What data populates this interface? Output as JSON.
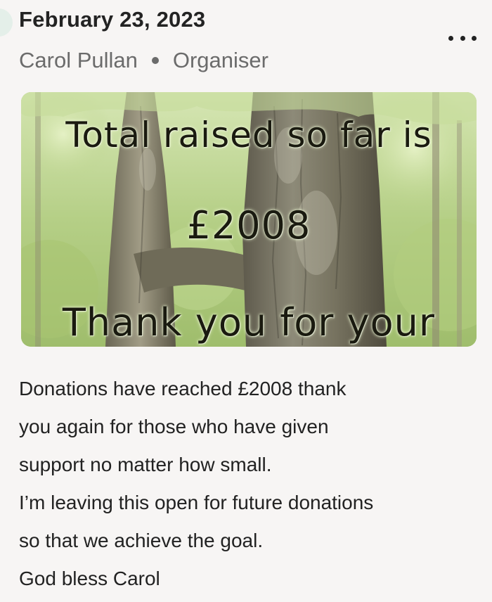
{
  "update": {
    "date": "February 23, 2023",
    "author": "Carol Pullan",
    "role": "Organiser",
    "more_icon": "more-horizontal-icon",
    "image": {
      "overlay_line1": "Total raised so far is",
      "overlay_line2": "£2008",
      "overlay_line3": "Thank you for your"
    },
    "body_lines": [
      "Donations have reached £2008 thank",
      "you again for those who have given",
      "support no matter how small.",
      "I’m leaving this open for future donations",
      "so that we achieve the goal.",
      "God bless Carol"
    ]
  },
  "colors": {
    "background": "#f7f5f4",
    "date_text": "#232323",
    "meta_text": "#6b6b6b",
    "accent_timeline": "#e4efe9"
  }
}
